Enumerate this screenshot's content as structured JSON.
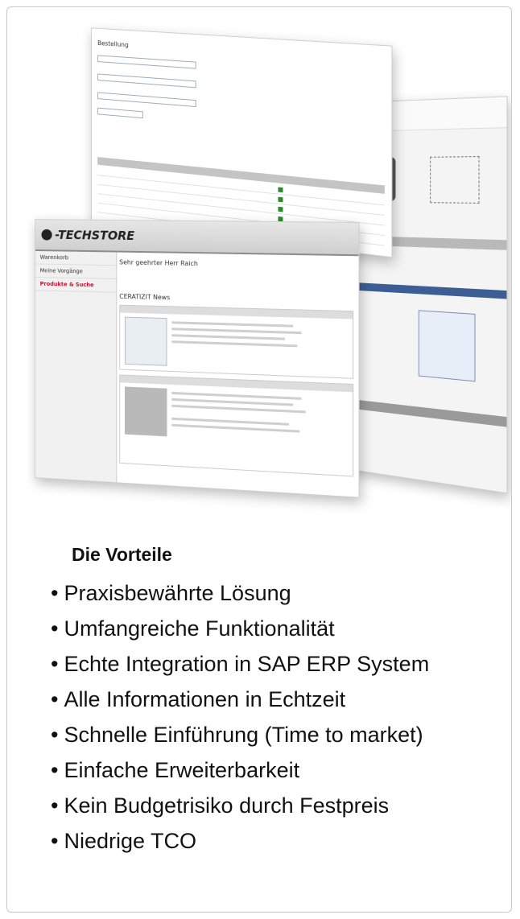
{
  "collage": {
    "order_form": {
      "title": "Bestellung"
    },
    "techstore": {
      "logo_text": "-TECHSTORE",
      "nav_items": [
        "Warenkorb",
        "Meine Vorgänge",
        "Produkte & Suche"
      ],
      "greeting": "Sehr geehrter Herr Raich",
      "news_heading": "CERATIZIT News"
    }
  },
  "benefits": {
    "heading": "Die Vorteile",
    "bullet": "•",
    "items": [
      "Praxisbewährte Lösung",
      "Umfangreiche Funktionalität",
      "Echte Integration in SAP ERP System",
      "Alle Informationen in Echtzeit",
      "Schnelle Einführung (Time to market)",
      "Einfache Erweiterbarkeit",
      "Kein Budgetrisiko durch Festpreis",
      "Niedrige TCO"
    ]
  }
}
